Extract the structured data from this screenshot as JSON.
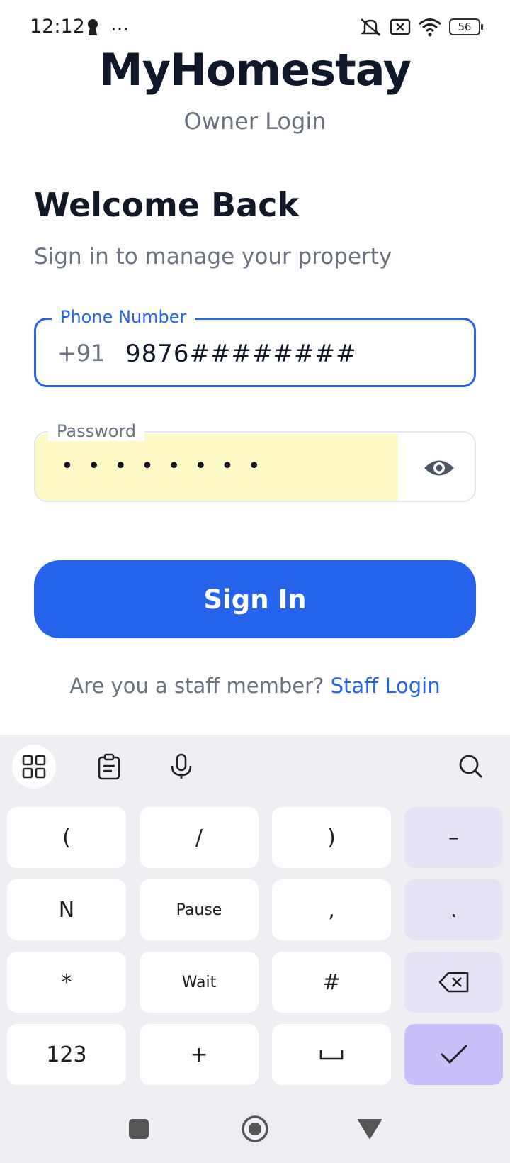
{
  "status_bar": {
    "time": "12:12",
    "dots": "…",
    "battery": "56"
  },
  "header": {
    "app_title": "MyHomestay",
    "subtitle": "Owner Login"
  },
  "welcome": {
    "title": "Welcome Back",
    "subtitle": "Sign in to manage your property"
  },
  "phone_field": {
    "label": "Phone Number",
    "prefix": "+91",
    "value": "9876########"
  },
  "password_field": {
    "label": "Password",
    "masked_value": "••••••••"
  },
  "sign_in_button": "Sign In",
  "staff": {
    "prompt": "Are you a staff member?",
    "link": "Staff Login"
  },
  "keyboard": {
    "rows": [
      [
        "(",
        "/",
        ")",
        "–"
      ],
      [
        "N",
        "Pause",
        ",",
        "."
      ],
      [
        "*",
        "Wait",
        "#",
        "backspace-icon"
      ],
      [
        "123",
        "+",
        "␣",
        "check-icon"
      ]
    ]
  },
  "colors": {
    "primary": "#2563eb",
    "autofill": "#fefac6",
    "keyboard_bg": "#f0eef3",
    "enter_key": "#c8c0fa"
  }
}
